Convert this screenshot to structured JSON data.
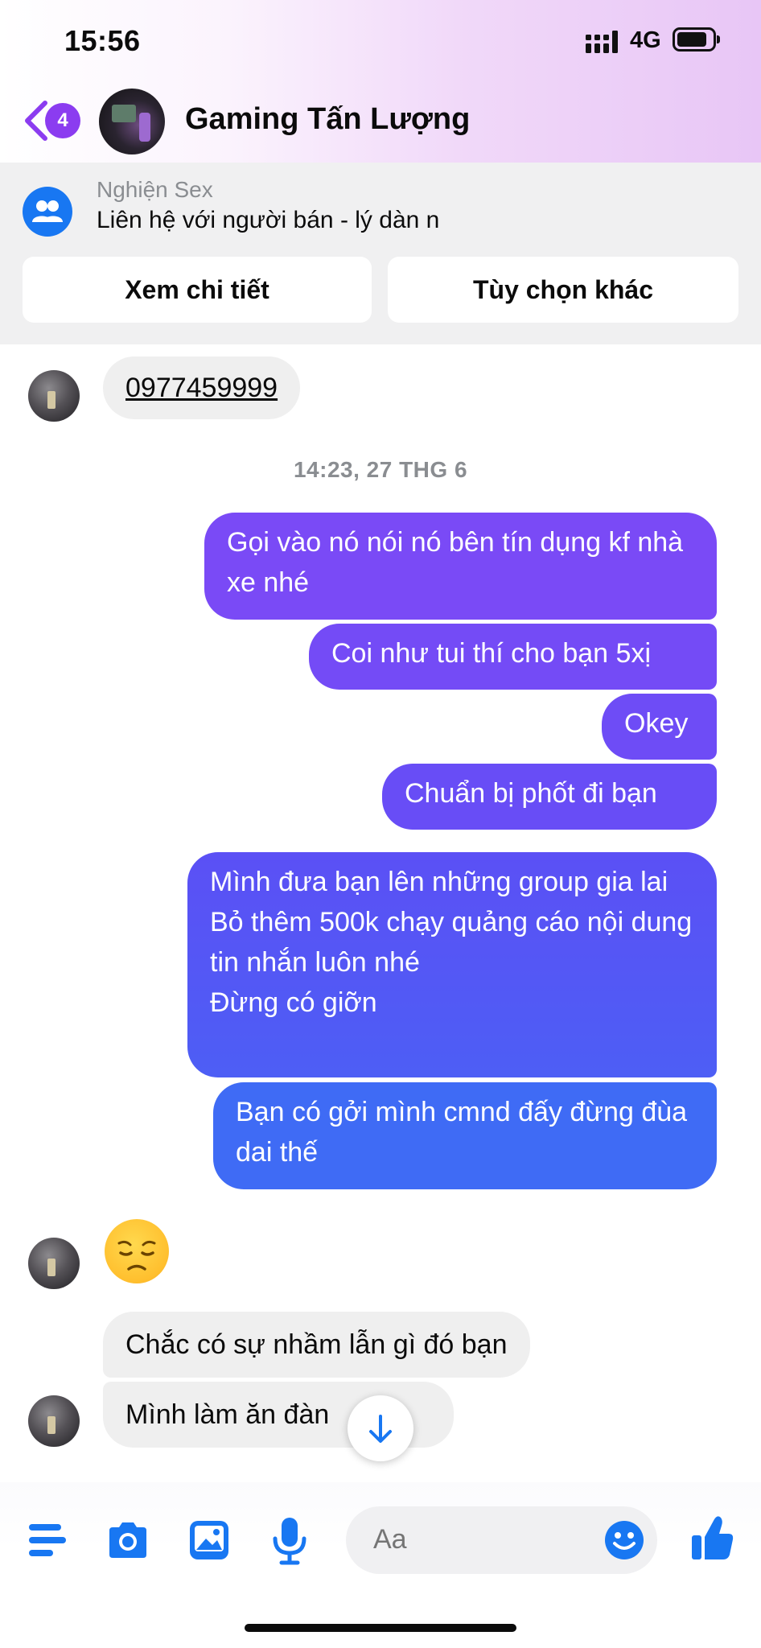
{
  "status_bar": {
    "time": "15:56",
    "network": "4G"
  },
  "header": {
    "back_badge": "4",
    "contact_name": "Gaming Tấn Lượng"
  },
  "marketplace": {
    "group_name": "Nghiện Sex",
    "listing": "Liên hệ với người bán - lý dàn n",
    "details_button": "Xem chi tiết",
    "options_button": "Tùy chọn khác"
  },
  "messages": {
    "phone": "0977459999",
    "timestamp": "14:23, 27 THG 6",
    "out": [
      "Gọi vào nó nói nó bên tín dụng kf nhà xe nhé",
      "Coi như tui thí cho bạn 5xị",
      "Okey",
      "Chuẩn bị phốt đi bạn",
      "Mình đưa bạn lên những group gia lai\nBỏ thêm 500k chạy quảng cáo nội dung tin nhắn luôn nhé\nĐừng có giỡn",
      "Bạn có gởi mình cmnd đấy đừng đùa dai thế"
    ],
    "in_reaction_emoji": "disappointed-face",
    "in_1": "Chắc có sự nhầm lẫn gì đó bạn",
    "in_2": "Mình làm ăn đàn    n"
  },
  "composer": {
    "placeholder": "Aa"
  },
  "colors": {
    "accent": "#1877f2",
    "badge": "#8b3cf0",
    "bubble_out_top": "#7c4af6",
    "bubble_out_bottom": "#3d6cf5",
    "bubble_in": "#efefef"
  }
}
